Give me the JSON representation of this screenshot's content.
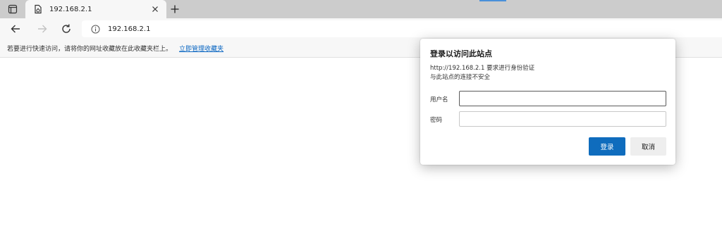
{
  "browser": {
    "tab_title": "192.168.2.1",
    "new_tab": "+",
    "address": "192.168.2.1",
    "icons": {
      "tab_actions": "tab-actions-icon",
      "favicon": "page-favicon-icon",
      "close": "close-icon",
      "back": "back-arrow-icon",
      "forward": "forward-arrow-icon",
      "refresh": "refresh-icon",
      "info": "info-icon"
    },
    "accent_color": "#4a90d9"
  },
  "favorites_bar": {
    "hint": "若要进行快速访问，请将你的网址收藏放在此收藏夹栏上。",
    "link": "立即管理收藏夹"
  },
  "auth_dialog": {
    "title": "登录以访问此站点",
    "message_line1": "http://192.168.2.1 要求进行身份验证",
    "message_line2": "与此站点的连接不安全",
    "username_label": "用户名",
    "username_value": "",
    "password_label": "密码",
    "password_value": "",
    "login_button": "登录",
    "cancel_button": "取消",
    "primary_color": "#0f6cbd"
  }
}
